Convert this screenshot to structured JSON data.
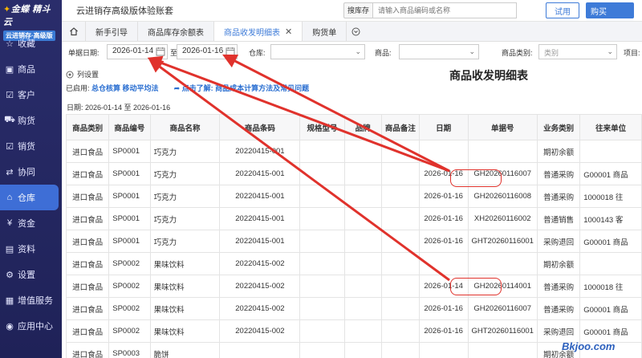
{
  "logo": {
    "name": "金蝶",
    "suffix": "精斗云",
    "edition": "云进销存·高级版"
  },
  "sidebar": {
    "items": [
      {
        "label": "收藏",
        "icon": "star-icon"
      },
      {
        "label": "商品",
        "icon": "box-icon"
      },
      {
        "label": "客户",
        "icon": "customer-icon"
      },
      {
        "label": "购货",
        "icon": "cart-icon"
      },
      {
        "label": "销货",
        "icon": "sales-icon"
      },
      {
        "label": "协同",
        "icon": "collab-icon"
      },
      {
        "label": "仓库",
        "icon": "warehouse-icon",
        "active": true
      },
      {
        "label": "资金",
        "icon": "money-icon"
      },
      {
        "label": "资料",
        "icon": "document-icon"
      },
      {
        "label": "设置",
        "icon": "gear-icon"
      },
      {
        "label": "增值服务",
        "icon": "service-icon"
      },
      {
        "label": "应用中心",
        "icon": "app-center-icon"
      }
    ]
  },
  "topbar": {
    "title": "云进销存高级版体验账套",
    "search_label": "搜库存",
    "search_placeholder": "请输入商品编码或名称",
    "trial_label": "试用",
    "buy_label": "购买"
  },
  "tabs": [
    {
      "label": "新手引导"
    },
    {
      "label": "商品库存余额表"
    },
    {
      "label": "商品收发明细表",
      "active": true
    },
    {
      "label": "购货单"
    }
  ],
  "filters": {
    "date_label": "单据日期:",
    "date_from": "2026-01-14",
    "to_label": "至",
    "date_to": "2026-01-16",
    "warehouse_label": "仓库:",
    "product_label": "商品:",
    "category_label": "商品类别:",
    "category_placeholder": "类别",
    "project_label": "项目:"
  },
  "info": {
    "column_settings": "列设置",
    "enabled_prefix": "已启用:",
    "enabled_value": "总仓核算 移动平均法",
    "tip_prefix": "点击了解:",
    "tip_value": "商品成本计算方法及常见问题",
    "date_range": "日期: 2026-01-14 至 2026-01-16",
    "report_title": "商品收发明细表"
  },
  "table": {
    "headers": [
      "商品类别",
      "商品编号",
      "商品名称",
      "商品条码",
      "规格型号",
      "品牌",
      "商品备注",
      "日期",
      "单据号",
      "业务类别",
      "往来单位"
    ],
    "rows": [
      [
        "进口食品",
        "SP0001",
        "巧克力",
        "20220415-001",
        "",
        "",
        "",
        "",
        "",
        "期初余额",
        ""
      ],
      [
        "进口食品",
        "SP0001",
        "巧克力",
        "20220415-001",
        "",
        "",
        "",
        "2026-01-16",
        "GH20260116007",
        "普通采购",
        "G00001 商品"
      ],
      [
        "进口食品",
        "SP0001",
        "巧克力",
        "20220415-001",
        "",
        "",
        "",
        "2026-01-16",
        "GH20260116008",
        "普通采购",
        "1000018 往"
      ],
      [
        "进口食品",
        "SP0001",
        "巧克力",
        "20220415-001",
        "",
        "",
        "",
        "2026-01-16",
        "XH20260116002",
        "普通销售",
        "1000143 客"
      ],
      [
        "进口食品",
        "SP0001",
        "巧克力",
        "20220415-001",
        "",
        "",
        "",
        "2026-01-16",
        "GHT20260116001",
        "采购退回",
        "G00001 商品"
      ],
      [
        "进口食品",
        "SP0002",
        "果味饮料",
        "20220415-002",
        "",
        "",
        "",
        "",
        "",
        "期初余额",
        ""
      ],
      [
        "进口食品",
        "SP0002",
        "果味饮料",
        "20220415-002",
        "",
        "",
        "",
        "2026-01-14",
        "GH20260114001",
        "普通采购",
        "1000018 往"
      ],
      [
        "进口食品",
        "SP0002",
        "果味饮料",
        "20220415-002",
        "",
        "",
        "",
        "2026-01-16",
        "GH20260116007",
        "普通采购",
        "G00001 商品"
      ],
      [
        "进口食品",
        "SP0002",
        "果味饮料",
        "20220415-002",
        "",
        "",
        "",
        "2026-01-16",
        "GHT20260116001",
        "采购退回",
        "G00001 商品"
      ],
      [
        "进口食品",
        "SP0003",
        "脆饼",
        "",
        "",
        "",
        "",
        "",
        "",
        "期初余额",
        ""
      ]
    ]
  },
  "watermark": "Bkjoo.com"
}
